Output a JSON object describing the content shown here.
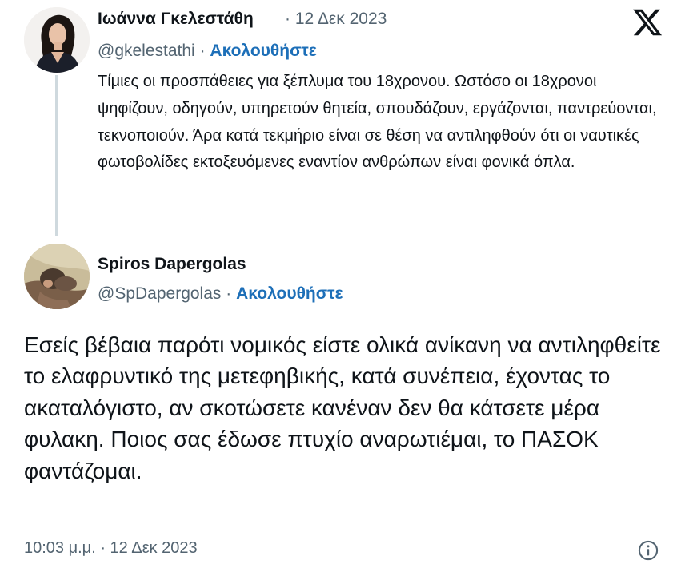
{
  "quoted_tweet": {
    "author_name": "Ιωάννα Γκελεστάθη",
    "separator": "·",
    "date": "12 Δεκ 2023",
    "handle": "@gkelestathi",
    "follow_label": "Ακολουθήστε",
    "text": "Τίμιες οι προσπάθειες για ξέπλυμα του 18χρονου. Ωστόσο οι 18χρονοι ψηφίζουν, οδηγούν, υπηρετούν θητεία, σπουδάζουν, εργάζονται, παντρεύονται, τεκνοποιούν. Άρα κατά τεκμήριο είναι σε θέση να αντιληφθούν ότι οι ναυτικές φωτοβολίδες εκτοξευόμενες εναντίον ανθρώπων είναι φονικά όπλα."
  },
  "reply_tweet": {
    "author_name": "Spiros Dapergolas",
    "separator": "·",
    "handle": "@SpDapergolas",
    "follow_label": "Ακολουθήστε",
    "text": "Εσείς βέβαια παρότι νομικός είστε ολικά ανίκανη να αντιληφθείτε το ελαφρυντικό της μετεφηβικής, κατά συνέπεια, έχοντας το ακαταλόγιστο, αν σκοτώσετε κανέναν δεν θα κάτσετε μέρα φυλακη. Ποιος σας έδωσε πτυχίο αναρωτιέμαι, το ΠΑΣΟΚ φαντάζομαι.",
    "timestamp": "10:03 μ.μ. · 12 Δεκ 2023"
  },
  "icons": {
    "brand": "x-logo-icon",
    "info": "info-icon"
  },
  "colors": {
    "follow": "#1d6fb8",
    "secondary_text": "#536471",
    "primary_text": "#0f1419",
    "thread_line": "#cfd9de"
  }
}
